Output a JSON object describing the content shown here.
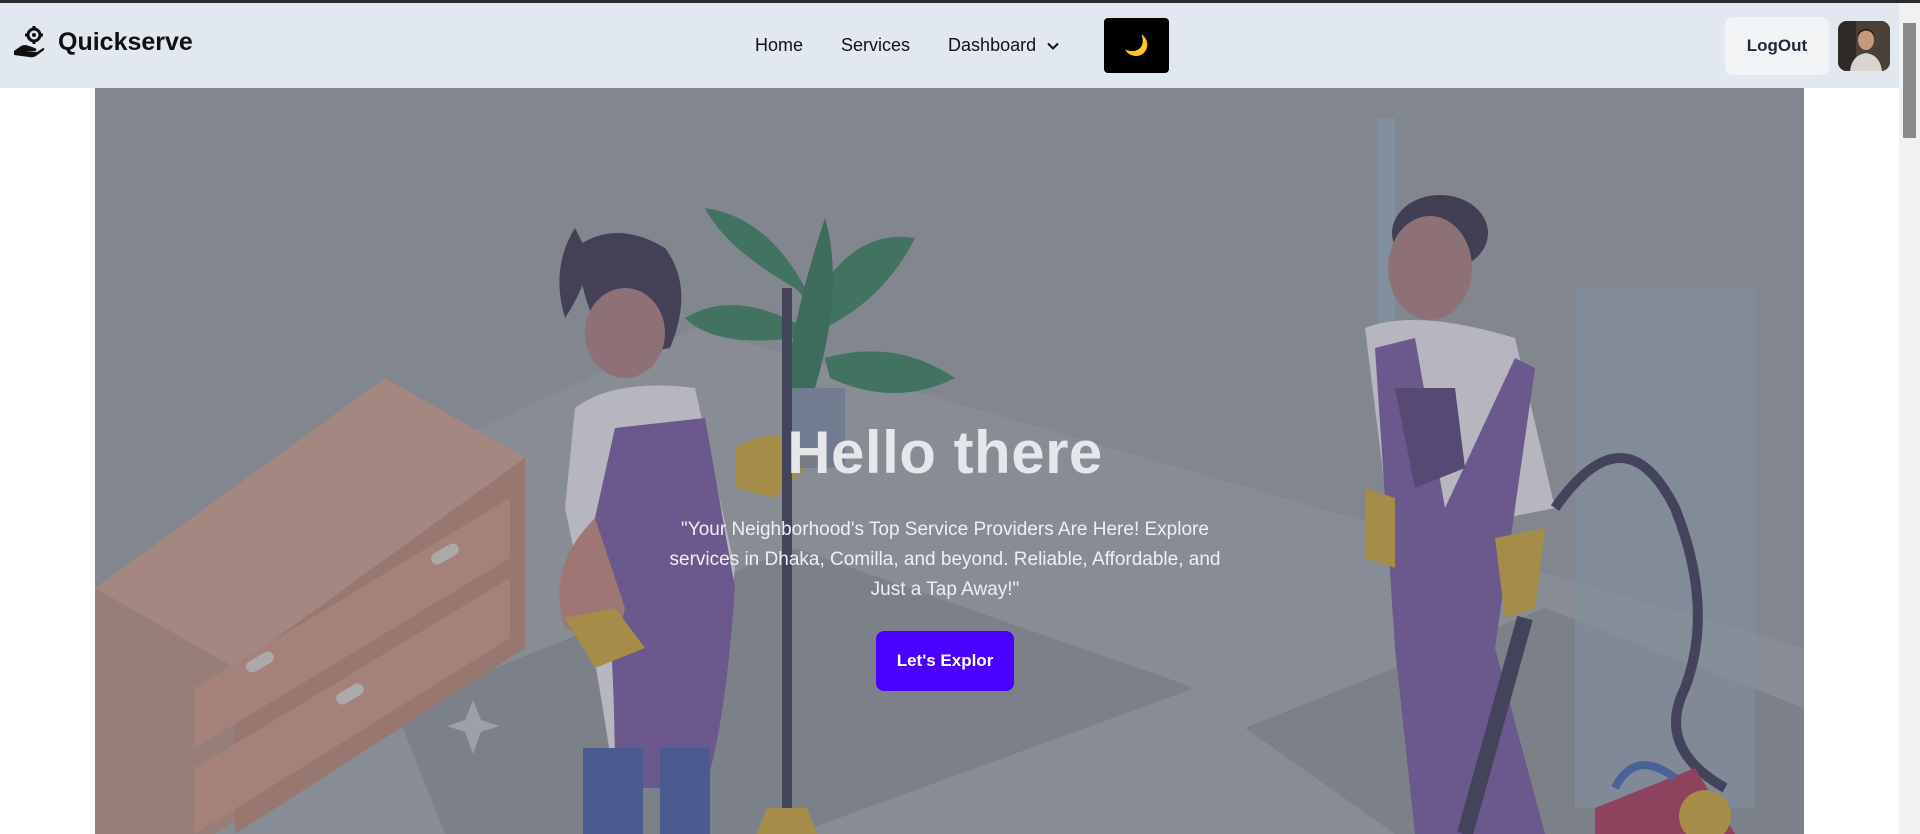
{
  "brand": {
    "name": "Quickserve",
    "logo_icon": "hand-gear-icon"
  },
  "nav": {
    "home": "Home",
    "services": "Services",
    "dashboard": "Dashboard",
    "dashboard_icon": "chevron-down-icon"
  },
  "theme_toggle": {
    "icon": "moon-icon",
    "glyph": "🌙"
  },
  "account": {
    "logout_label": "LogOut",
    "avatar_icon": "user-avatar"
  },
  "hero": {
    "title": "Hello there",
    "text": "\"Your Neighborhood's Top Service Providers Are Here! Explore services in Dhaka, Comilla, and beyond. Reliable, Affordable, and Just a Tap Away!\"",
    "button_label": "Let's Explor",
    "button_color": "#4a00ff"
  },
  "colors": {
    "navbar_bg": "#e2e8f0",
    "theme_toggle_bg": "#000000"
  }
}
